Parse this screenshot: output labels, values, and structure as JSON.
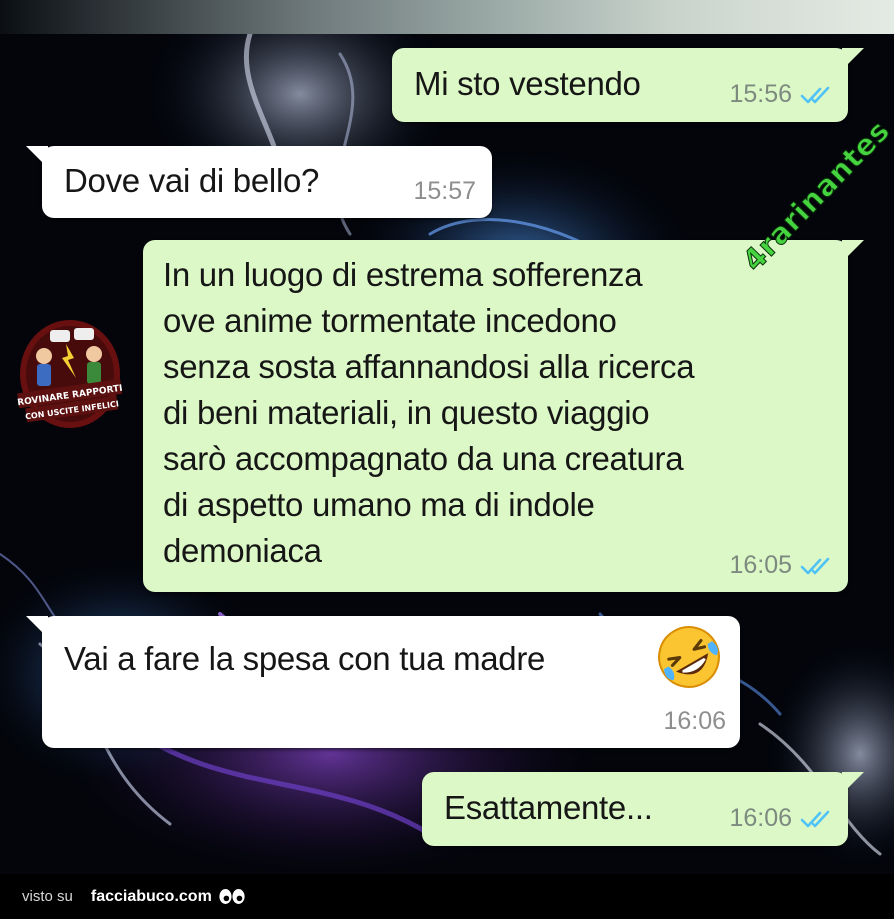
{
  "conversation": {
    "messages": [
      {
        "direction": "sent",
        "text": "Mi sto vestendo",
        "time": "15:56",
        "status_icon": "double-check-icon"
      },
      {
        "direction": "received",
        "text": "Dove vai di bello?",
        "time": "15:57"
      },
      {
        "direction": "sent",
        "text": "In un luogo di estrema sofferenza\nove anime tormentate incedono\nsenza sosta affannandosi alla ricerca\ndi beni materiali, in questo viaggio\nsarò accompagnato da una creatura\ndi aspetto umano ma di indole\ndemoniaca",
        "time": "16:05",
        "status_icon": "double-check-icon"
      },
      {
        "direction": "received",
        "text": "Vai a fare la spesa con tua madre",
        "emoji": "rolling-on-floor-laughing-emoji",
        "time": "16:06"
      },
      {
        "direction": "sent",
        "text": "Esattamente...",
        "time": "16:06",
        "status_icon": "double-check-icon"
      }
    ]
  },
  "overlays": {
    "watermark_text": "4rarinantes",
    "stamp_lines": [
      "ROVINARE RAPPORTI",
      "CON USCITE INFELICI"
    ]
  },
  "footer": {
    "prefix": "visto su",
    "site": "facciabuco.com",
    "icon": "eyes-icon"
  },
  "colors": {
    "sent_bubble": "#dcf8c6",
    "received_bubble": "#ffffff",
    "read_ticks": "#4fc3f7",
    "watermark": "#45d43f"
  }
}
